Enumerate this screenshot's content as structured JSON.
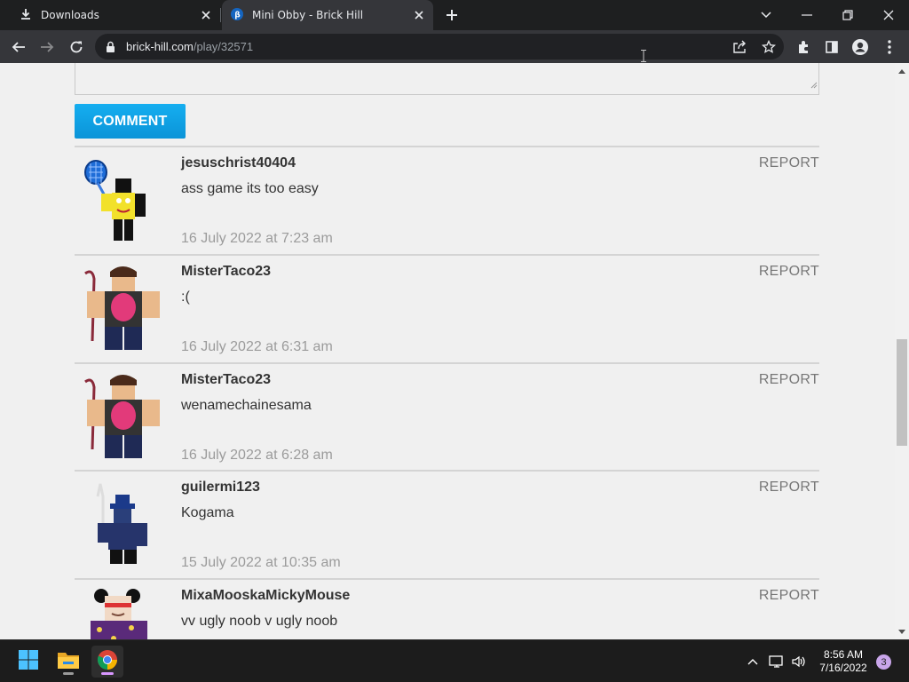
{
  "browser": {
    "tabs": [
      {
        "title": "Downloads",
        "icon": "download-icon",
        "active": false
      },
      {
        "title": "Mini Obby - Brick Hill",
        "icon": "brick-hill-favicon",
        "active": true
      }
    ],
    "url_domain": "brick-hill.com",
    "url_path": "/play/32571"
  },
  "page": {
    "comment_button_label": "COMMENT",
    "comments": [
      {
        "user": "jesuschrist40404",
        "text": "ass game its too easy",
        "date": "16 July 2022 at 7:23 am",
        "report": "REPORT"
      },
      {
        "user": "MisterTaco23",
        "text": ":(",
        "date": "16 July 2022 at 6:31 am",
        "report": "REPORT"
      },
      {
        "user": "MisterTaco23",
        "text": "wenamechainesama",
        "date": "16 July 2022 at 6:28 am",
        "report": "REPORT"
      },
      {
        "user": "guilermi123",
        "text": "Kogama",
        "date": "15 July 2022 at 10:35 am",
        "report": "REPORT"
      },
      {
        "user": "MixaMooskaMickyMouse",
        "text": "vv ugly noob v ugly noob",
        "date": "",
        "report": "REPORT"
      }
    ]
  },
  "taskbar": {
    "time": "8:56 AM",
    "date": "7/16/2022",
    "notification_count": "3"
  },
  "colors": {
    "accent": "#0ea5e9",
    "page_bg": "#f0f0f0",
    "tab_active": "#35363a"
  }
}
